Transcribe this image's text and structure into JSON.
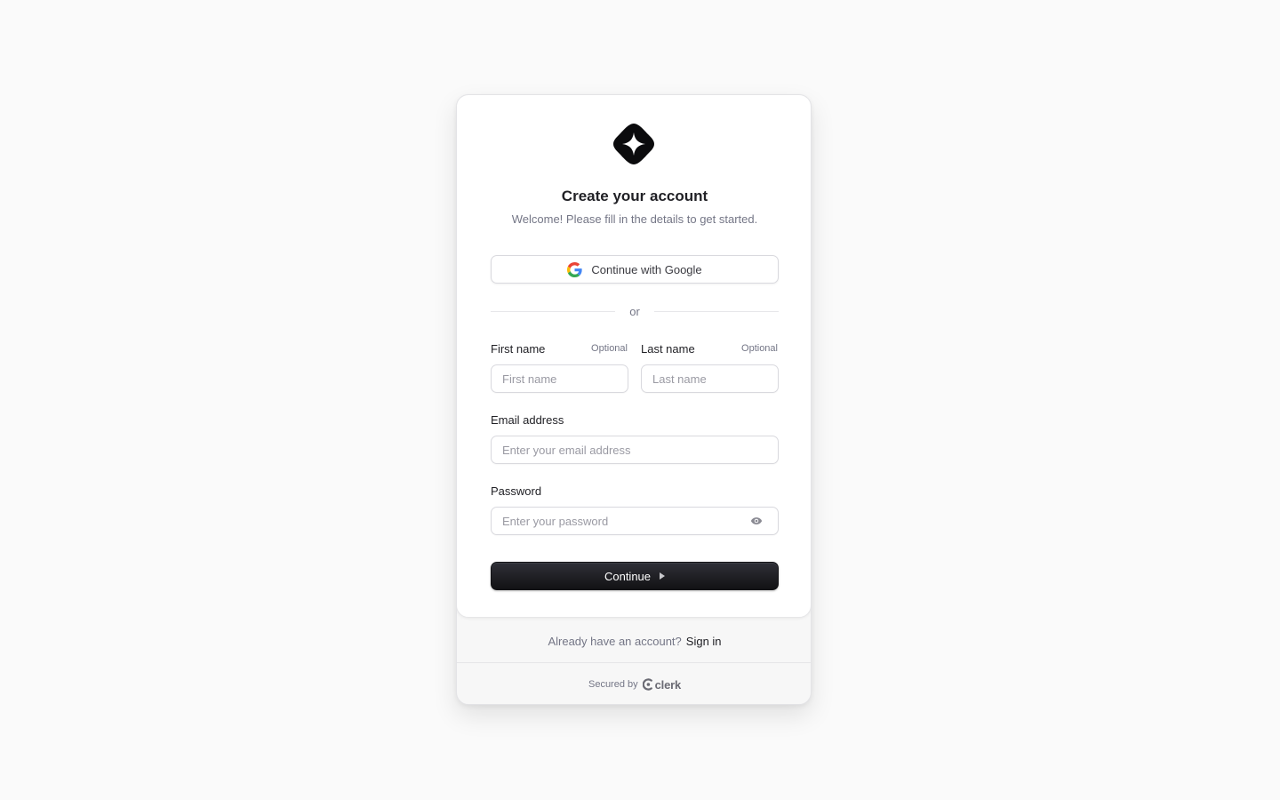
{
  "header": {
    "logo": "diamond-logo-icon",
    "title": "Create your account",
    "subtitle": "Welcome! Please fill in the details to get started."
  },
  "social": {
    "google_label": "Continue with Google",
    "google_icon": "google-icon"
  },
  "divider": {
    "text": "or"
  },
  "form": {
    "first_name": {
      "label": "First name",
      "optional": "Optional",
      "placeholder": "First name",
      "value": ""
    },
    "last_name": {
      "label": "Last name",
      "optional": "Optional",
      "placeholder": "Last name",
      "value": ""
    },
    "email": {
      "label": "Email address",
      "placeholder": "Enter your email address",
      "value": ""
    },
    "password": {
      "label": "Password",
      "placeholder": "Enter your password",
      "value": "",
      "toggle_icon": "eye-icon"
    },
    "submit_label": "Continue",
    "submit_icon": "caret-right-icon"
  },
  "footer": {
    "prompt": "Already have an account?",
    "signin_link": "Sign in",
    "secured_by": "Secured by",
    "brand": "clerk",
    "brand_icon": "clerk-logo-icon"
  },
  "colors": {
    "background": "#fafafa",
    "card": "#ffffff",
    "footer": "#f7f7f7",
    "primary_button": "#212126",
    "muted_text": "#747686",
    "border": "#d9d9de"
  }
}
